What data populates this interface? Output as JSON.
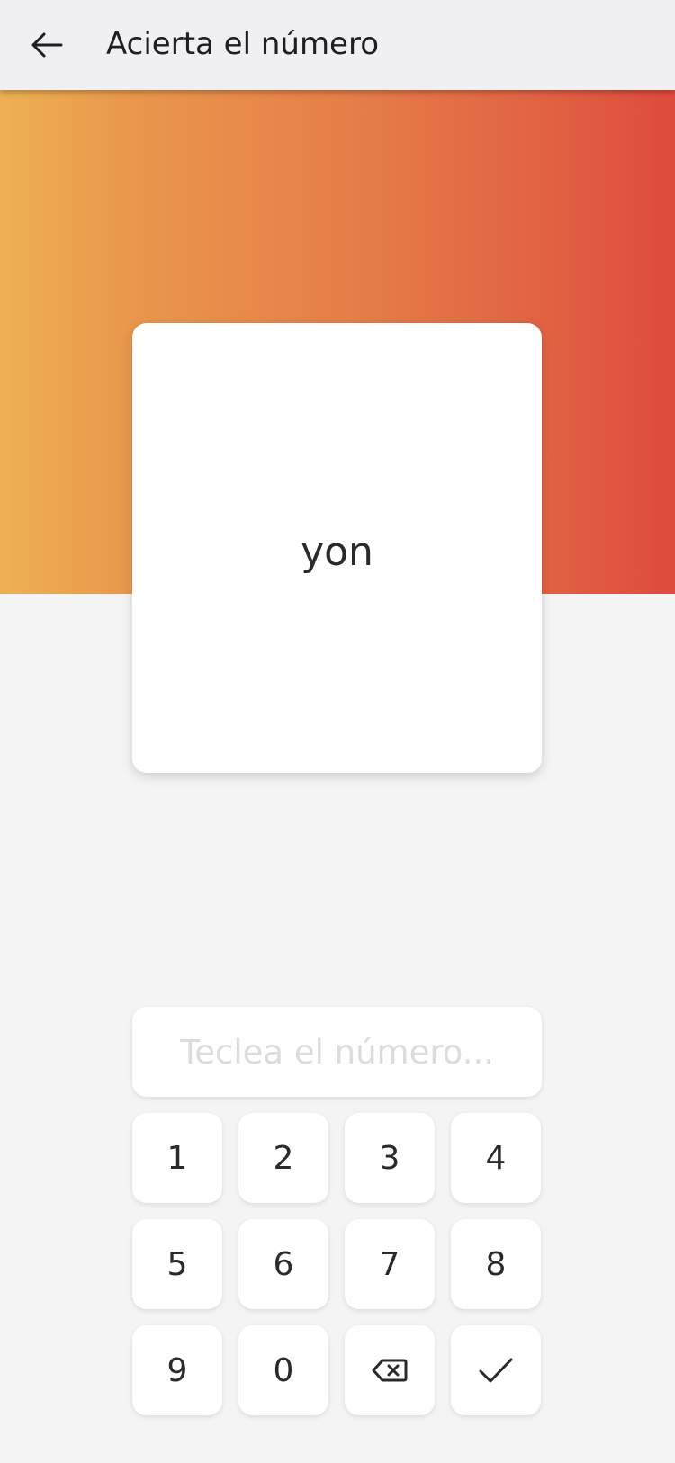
{
  "app_bar": {
    "back_icon": "arrow-left-icon",
    "title": "Acierta el número"
  },
  "hero": {
    "gradient_colors": [
      "#edb152",
      "#e57d48",
      "#de4b3e"
    ]
  },
  "card": {
    "word": "yon"
  },
  "input": {
    "value": "",
    "placeholder": "Teclea el número..."
  },
  "keypad": {
    "keys": [
      "1",
      "2",
      "3",
      "4",
      "5",
      "6",
      "7",
      "8",
      "9",
      "0"
    ],
    "backspace_icon": "backspace-icon",
    "confirm_icon": "check-icon"
  }
}
